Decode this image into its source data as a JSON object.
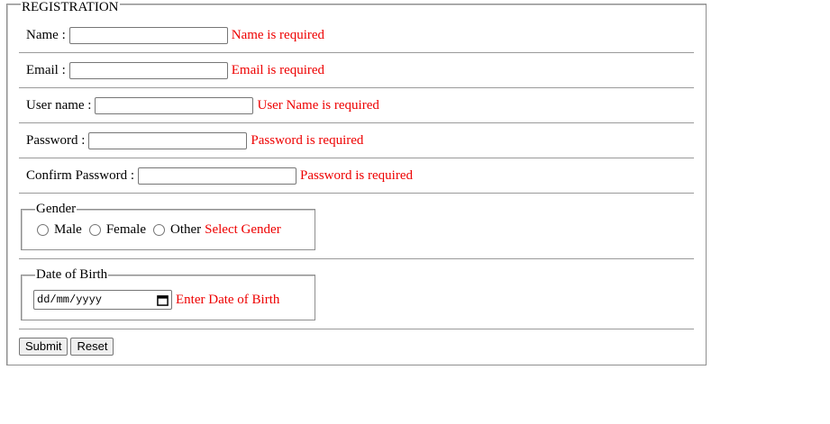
{
  "form": {
    "legend": "REGISTRATION",
    "fields": {
      "name": {
        "label": "Name :",
        "value": "",
        "error": "Name is required"
      },
      "email": {
        "label": "Email :",
        "value": "",
        "error": "Email is required"
      },
      "username": {
        "label": "User name :",
        "value": "",
        "error": "User Name is required"
      },
      "password": {
        "label": "Password :",
        "value": "",
        "error": "Password is required"
      },
      "confirm_password": {
        "label": "Confirm Password :",
        "value": "",
        "error": "Password is required"
      }
    },
    "gender": {
      "legend": "Gender",
      "options": [
        "Male",
        "Female",
        "Other"
      ],
      "error": "Select Gender"
    },
    "dob": {
      "legend": "Date of Birth",
      "placeholder": "dd/mm/yyyy",
      "error": "Enter Date of Birth"
    },
    "buttons": {
      "submit": "Submit",
      "reset": "Reset"
    }
  }
}
